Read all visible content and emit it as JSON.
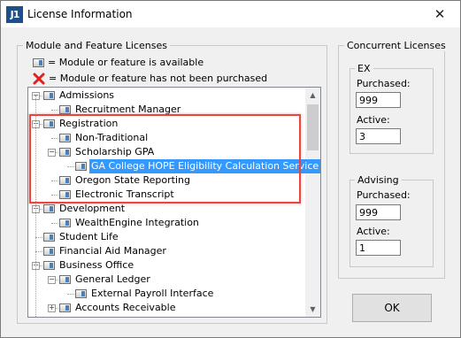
{
  "window": {
    "title": "License Information",
    "app_icon_text": "J1",
    "close_glyph": "✕"
  },
  "licenses": {
    "group_label": "Module and Feature Licenses",
    "legend_available": "= Module or feature is available",
    "legend_not_purchased": "= Module or feature has not been purchased",
    "tree": [
      {
        "label": "Admissions",
        "expander": "−"
      },
      {
        "label": "Recruitment Manager"
      },
      {
        "label": "Registration",
        "expander": "−"
      },
      {
        "label": "Non-Traditional"
      },
      {
        "label": "Scholarship GPA",
        "expander": "−"
      },
      {
        "label": "GA College HOPE Eligibility Calculation Service",
        "selected": true
      },
      {
        "label": "Oregon State Reporting"
      },
      {
        "label": "Electronic Transcript"
      },
      {
        "label": "Development",
        "expander": "−"
      },
      {
        "label": "WealthEngine Integration"
      },
      {
        "label": "Student Life"
      },
      {
        "label": "Financial Aid Manager"
      },
      {
        "label": "Business Office",
        "expander": "−"
      },
      {
        "label": "General Ledger",
        "expander": "−"
      },
      {
        "label": "External Payroll Interface"
      },
      {
        "label": "Accounts Receivable",
        "expander": "+"
      }
    ]
  },
  "concurrent": {
    "group_label": "Concurrent Licenses",
    "ex": {
      "label": "EX",
      "purchased_label": "Purchased:",
      "purchased_value": "999",
      "active_label": "Active:",
      "active_value": "3"
    },
    "advising": {
      "label": "Advising",
      "purchased_label": "Purchased:",
      "purchased_value": "999",
      "active_label": "Active:",
      "active_value": "1"
    }
  },
  "buttons": {
    "ok": "OK"
  },
  "colors": {
    "highlight_border": "#e8463e",
    "selection": "#3399ff",
    "not_purchased_x": "#e02020"
  }
}
